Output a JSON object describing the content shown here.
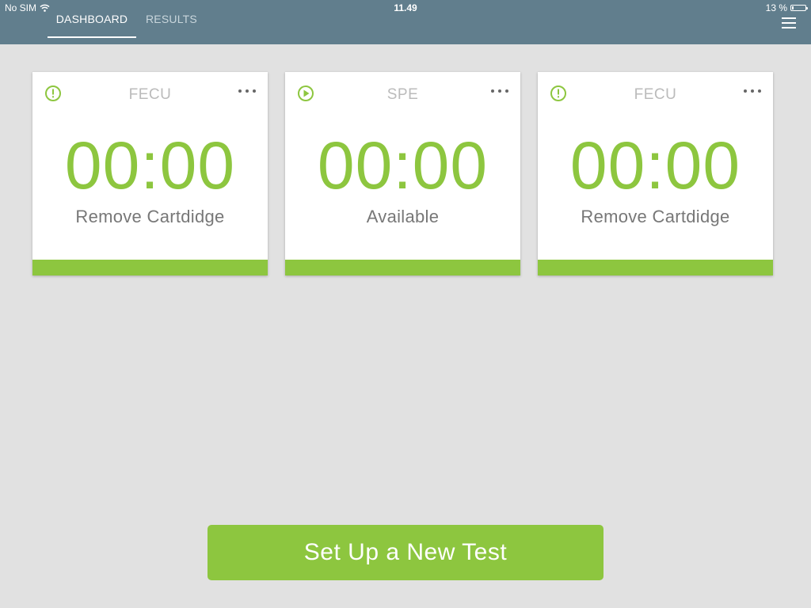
{
  "status_bar": {
    "carrier": "No SIM",
    "time": "11.49",
    "battery_text": "13 %",
    "battery_level": 0.13
  },
  "tabs": [
    {
      "label": "DASHBOARD",
      "active": true
    },
    {
      "label": "RESULTS",
      "active": false
    }
  ],
  "cards": [
    {
      "title": "FECU",
      "timer": "00:00",
      "status": "Remove Cartdidge",
      "icon": "alert-icon"
    },
    {
      "title": "SPE",
      "timer": "00:00",
      "status": "Available",
      "icon": "play-icon"
    },
    {
      "title": "FECU",
      "timer": "00:00",
      "status": "Remove Cartdidge",
      "icon": "alert-icon"
    }
  ],
  "cta_label": "Set Up a New Test",
  "colors": {
    "header": "#617e8d",
    "accent": "#8dc63f",
    "background": "#e1e1e1"
  }
}
